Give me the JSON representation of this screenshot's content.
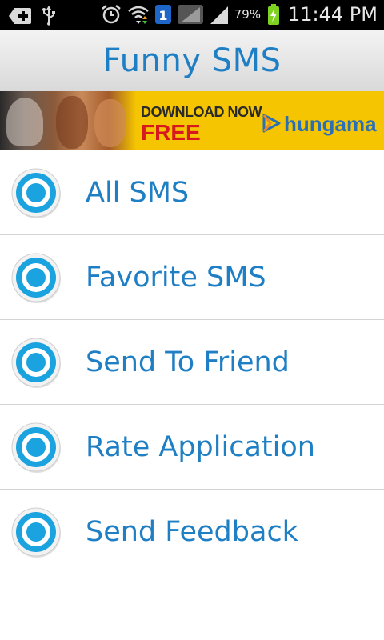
{
  "status_bar": {
    "icons_left": [
      "add-icon",
      "usb-icon"
    ],
    "icons_right": [
      "alarm-icon",
      "wifi-icon",
      "notification-badge-icon",
      "signal-icon",
      "signal-icon",
      "battery-charging-icon"
    ],
    "badge_text": "1",
    "battery_percent": "79%",
    "time": "11:44 PM"
  },
  "header": {
    "title": "Funny SMS"
  },
  "ad_banner": {
    "line1": "DOWNLOAD NOW",
    "line2": "FREE",
    "brand": "hungama",
    "brand_icon": "play-icon",
    "colors": {
      "background": "#f4c500",
      "free_text": "#d6181f",
      "brand_text": "#2b6fb6"
    }
  },
  "menu": {
    "items": [
      {
        "label": "All SMS",
        "icon": "ring-icon"
      },
      {
        "label": "Favorite SMS",
        "icon": "ring-icon"
      },
      {
        "label": "Send To Friend",
        "icon": "ring-icon"
      },
      {
        "label": "Rate Application",
        "icon": "ring-icon"
      },
      {
        "label": "Send Feedback",
        "icon": "ring-icon"
      }
    ]
  },
  "colors": {
    "accent": "#1f7fc4",
    "icon_blue": "#1ba3e0",
    "divider": "#d4d4d4"
  }
}
